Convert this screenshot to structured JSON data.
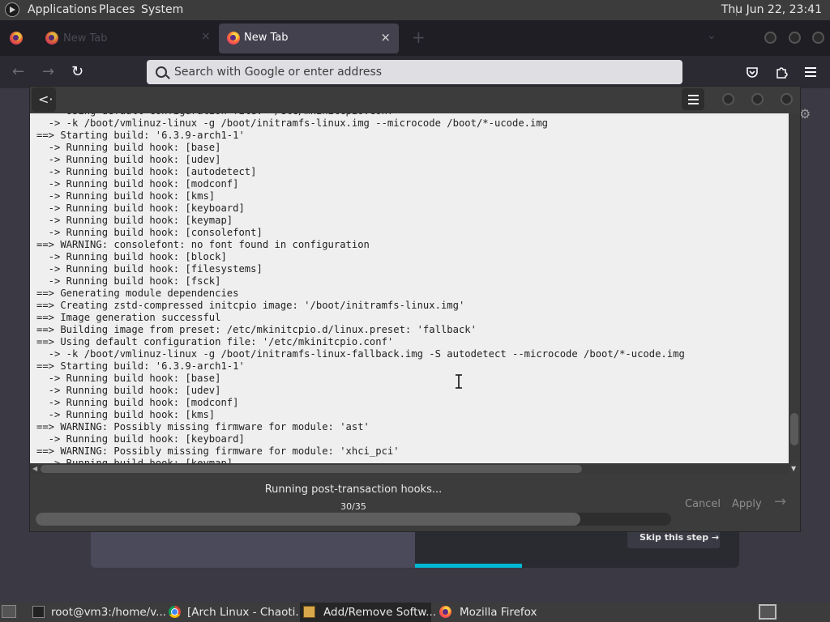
{
  "top_panel": {
    "menus": [
      "Applications",
      "Places",
      "System"
    ],
    "clock": "Thu Jun 22, 23:41"
  },
  "browser": {
    "inactive_tab_title": "New Tab",
    "active_tab_title": "New Tab",
    "tab_close_glyph": "×",
    "new_tab_glyph": "+",
    "tab_list_glyph": "⌄",
    "nav": {
      "back": "←",
      "forward": "→",
      "reload": "↻"
    },
    "address_placeholder": "Search with Google or enter address",
    "toolbar_icons": [
      "pocket-icon",
      "extensions-icon",
      "hamburger-menu-icon"
    ]
  },
  "background_page": {
    "skip_label": "Skip this step →",
    "progress_fraction": 0.33
  },
  "dialog": {
    "back_glyph": "<·",
    "terminal_lines": [
      "  -> Using default configuration file: '/etc/mkinitcpio.conf'",
      "  -> -k /boot/vmlinuz-linux -g /boot/initramfs-linux.img --microcode /boot/*-ucode.img",
      "==> Starting build: '6.3.9-arch1-1'",
      "  -> Running build hook: [base]",
      "  -> Running build hook: [udev]",
      "  -> Running build hook: [autodetect]",
      "  -> Running build hook: [modconf]",
      "  -> Running build hook: [kms]",
      "  -> Running build hook: [keyboard]",
      "  -> Running build hook: [keymap]",
      "  -> Running build hook: [consolefont]",
      "==> WARNING: consolefont: no font found in configuration",
      "  -> Running build hook: [block]",
      "  -> Running build hook: [filesystems]",
      "  -> Running build hook: [fsck]",
      "==> Generating module dependencies",
      "==> Creating zstd-compressed initcpio image: '/boot/initramfs-linux.img'",
      "==> Image generation successful",
      "==> Building image from preset: /etc/mkinitcpio.d/linux.preset: 'fallback'",
      "==> Using default configuration file: '/etc/mkinitcpio.conf'",
      "  -> -k /boot/vmlinuz-linux -g /boot/initramfs-linux-fallback.img -S autodetect --microcode /boot/*-ucode.img",
      "==> Starting build: '6.3.9-arch1-1'",
      "  -> Running build hook: [base]",
      "  -> Running build hook: [udev]",
      "  -> Running build hook: [modconf]",
      "  -> Running build hook: [kms]",
      "==> WARNING: Possibly missing firmware for module: 'ast'",
      "  -> Running build hook: [keyboard]",
      "==> WARNING: Possibly missing firmware for module: 'xhci_pci'",
      "  -> Running build hook: [keymap]"
    ],
    "status_text": "Running post-transaction hooks...",
    "progress_text": "30/35",
    "progress_fraction": 0.857,
    "cancel_label": "Cancel",
    "apply_label": "Apply",
    "next_glyph": "→"
  },
  "taskbar": {
    "items": [
      {
        "label": "root@vm3:/home/v...",
        "icon": "terminal-icon"
      },
      {
        "label": "[Arch Linux - Chaoti...",
        "icon": "chrome-icon"
      },
      {
        "label": "Add/Remove Softw...",
        "icon": "package-icon"
      },
      {
        "label": "Mozilla Firefox",
        "icon": "firefox-icon"
      }
    ]
  }
}
